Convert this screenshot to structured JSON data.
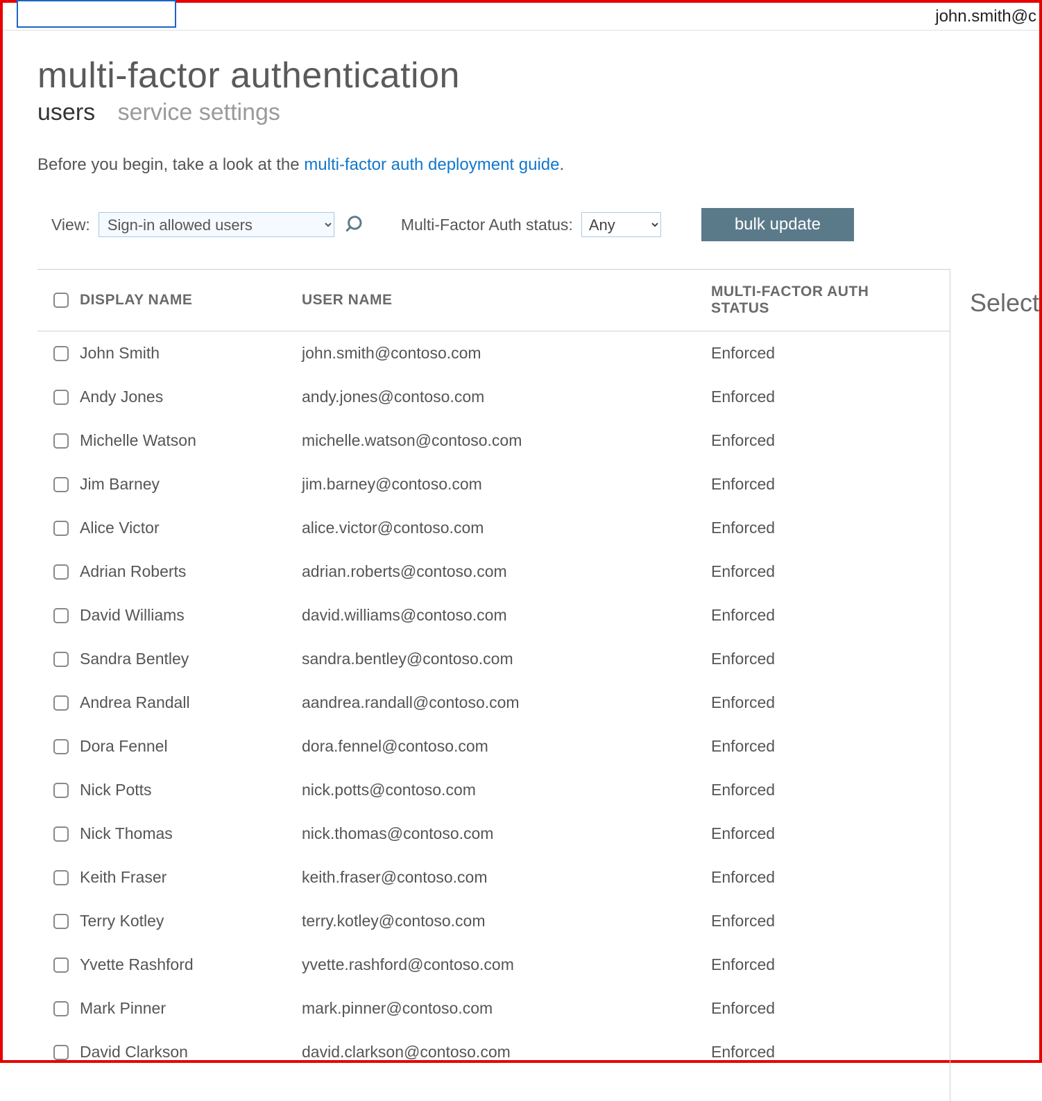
{
  "header": {
    "user_email": "john.smith@c"
  },
  "page": {
    "title": "multi-factor authentication",
    "tabs": [
      {
        "label": "users",
        "active": true
      },
      {
        "label": "service settings",
        "active": false
      }
    ],
    "intro_prefix": "Before you begin, take a look at the ",
    "intro_link": "multi-factor auth deployment guide",
    "intro_suffix": "."
  },
  "filters": {
    "view_label": "View:",
    "view_selected": "Sign-in allowed users",
    "status_label": "Multi-Factor Auth status:",
    "status_selected": "Any",
    "bulk_button": "bulk update"
  },
  "table": {
    "columns": {
      "display_name": "DISPLAY NAME",
      "user_name": "USER NAME",
      "status": "MULTI-FACTOR AUTH STATUS"
    },
    "rows": [
      {
        "display_name": "John Smith",
        "user_name": "john.smith@contoso.com",
        "status": "Enforced"
      },
      {
        "display_name": "Andy Jones",
        "user_name": "andy.jones@contoso.com",
        "status": "Enforced"
      },
      {
        "display_name": "Michelle Watson",
        "user_name": "michelle.watson@contoso.com",
        "status": "Enforced"
      },
      {
        "display_name": "Jim Barney",
        "user_name": "jim.barney@contoso.com",
        "status": "Enforced"
      },
      {
        "display_name": "Alice Victor",
        "user_name": "alice.victor@contoso.com",
        "status": "Enforced"
      },
      {
        "display_name": "Adrian Roberts",
        "user_name": "adrian.roberts@contoso.com",
        "status": "Enforced"
      },
      {
        "display_name": "David Williams",
        "user_name": "david.williams@contoso.com",
        "status": "Enforced"
      },
      {
        "display_name": "Sandra Bentley",
        "user_name": "sandra.bentley@contoso.com",
        "status": "Enforced"
      },
      {
        "display_name": "Andrea Randall",
        "user_name": "aandrea.randall@contoso.com",
        "status": "Enforced"
      },
      {
        "display_name": "Dora Fennel",
        "user_name": "dora.fennel@contoso.com",
        "status": "Enforced"
      },
      {
        "display_name": "Nick Potts",
        "user_name": "nick.potts@contoso.com",
        "status": "Enforced"
      },
      {
        "display_name": "Nick Thomas",
        "user_name": "nick.thomas@contoso.com",
        "status": "Enforced"
      },
      {
        "display_name": "Keith Fraser",
        "user_name": "keith.fraser@contoso.com",
        "status": "Enforced"
      },
      {
        "display_name": "Terry Kotley",
        "user_name": "terry.kotley@contoso.com",
        "status": "Enforced"
      },
      {
        "display_name": "Yvette Rashford",
        "user_name": "yvette.rashford@contoso.com",
        "status": "Enforced"
      },
      {
        "display_name": "Mark Pinner",
        "user_name": "mark.pinner@contoso.com",
        "status": "Enforced"
      },
      {
        "display_name": "David Clarkson",
        "user_name": "david.clarkson@contoso.com",
        "status": "Enforced"
      }
    ]
  },
  "side_panel": {
    "title": "Select"
  }
}
